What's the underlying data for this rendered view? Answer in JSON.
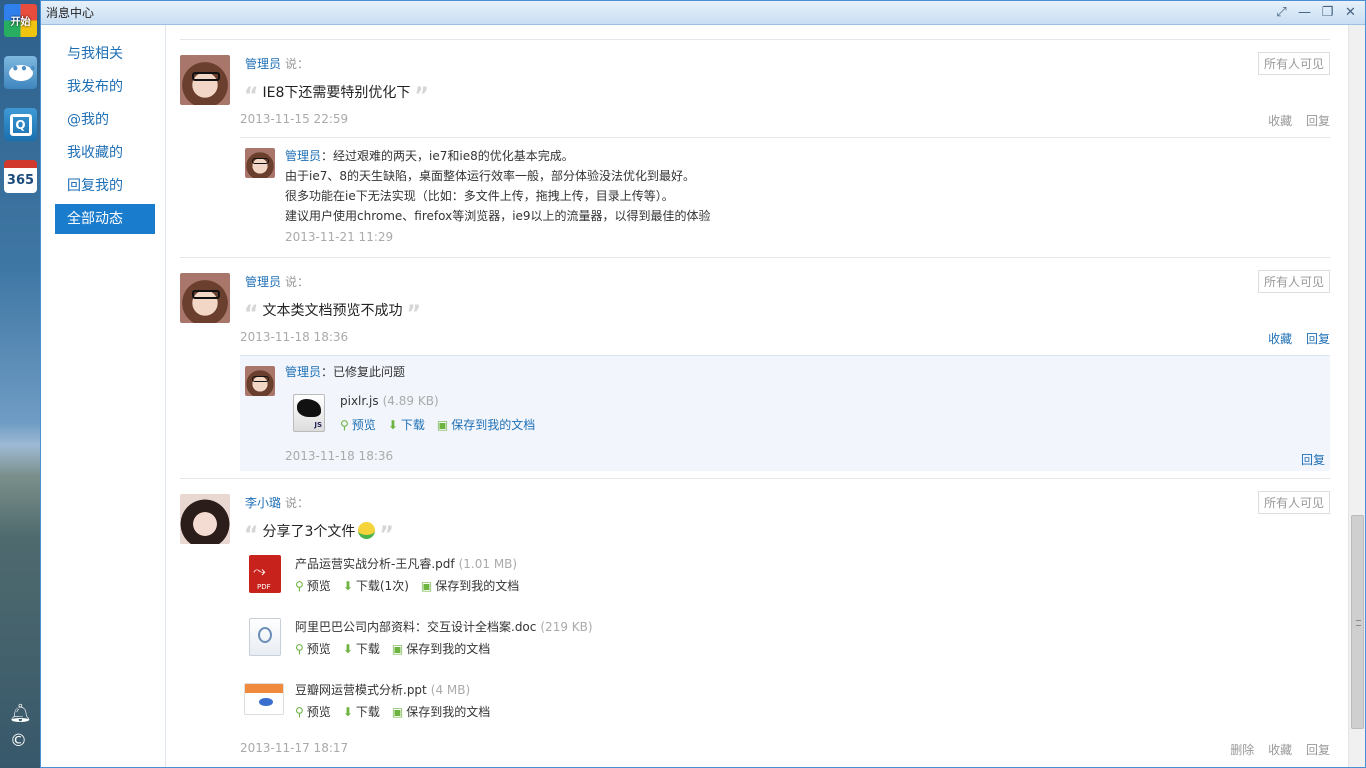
{
  "dock": {
    "start_label": "开始",
    "calendar_label": "365"
  },
  "window": {
    "title": "消息中心"
  },
  "sidebar": {
    "items": [
      {
        "label": "与我相关"
      },
      {
        "label": "我发布的"
      },
      {
        "label": "@我的"
      },
      {
        "label": "我收藏的"
      },
      {
        "label": "回复我的"
      },
      {
        "label": "全部动态",
        "active": true
      }
    ]
  },
  "posts": [
    {
      "author": "管理员",
      "says": "说：",
      "visibility": "所有人可见",
      "text": "IE8下还需要特别优化下",
      "time": "2013-11-15 22:59",
      "actions": [
        "收藏",
        "回复"
      ],
      "reply": {
        "author": "管理员",
        "colon": "：",
        "lines": [
          "经过艰难的两天，ie7和ie8的优化基本完成。",
          "由于ie7、8的天生缺陷，桌面整体运行效率一般，部分体验没法优化到最好。",
          "很多功能在ie下无法实现（比如：多文件上传，拖拽上传，目录上传等）。",
          "建议用户使用chrome、firefox等浏览器，ie9以上的流量器，以得到最佳的体验"
        ],
        "time": "2013-11-21 11:29"
      }
    },
    {
      "author": "管理员",
      "says": "说：",
      "visibility": "所有人可见",
      "text": "文本类文档预览不成功",
      "time": "2013-11-18 18:36",
      "actions": [
        "收藏",
        "回复"
      ],
      "reply": {
        "author": "管理员",
        "colon": "：",
        "text": "已修复此问题",
        "file": {
          "name": "pixlr.js",
          "size": "(4.89 KB)",
          "actions": [
            "预览",
            "下载",
            "保存到我的文档"
          ]
        },
        "time": "2013-11-18 18:36",
        "action": "回复"
      }
    },
    {
      "author": "李小璐",
      "says": "说：",
      "visibility": "所有人可见",
      "text": "分享了3个文件",
      "files": [
        {
          "name": "产品运营实战分析-王凡睿.pdf",
          "size": "(1.01 MB)",
          "actions": [
            "预览",
            "下载(1次)",
            "保存到我的文档"
          ]
        },
        {
          "name": "阿里巴巴公司内部资料：交互设计全档案.doc",
          "size": "(219 KB)",
          "actions": [
            "预览",
            "下载",
            "保存到我的文档"
          ]
        },
        {
          "name": "豆瓣网运营模式分析.ppt",
          "size": "(4 MB)",
          "actions": [
            "预览",
            "下载",
            "保存到我的文档"
          ]
        }
      ],
      "time": "2013-11-17 18:17",
      "actions": [
        "删除",
        "收藏",
        "回复"
      ]
    }
  ]
}
